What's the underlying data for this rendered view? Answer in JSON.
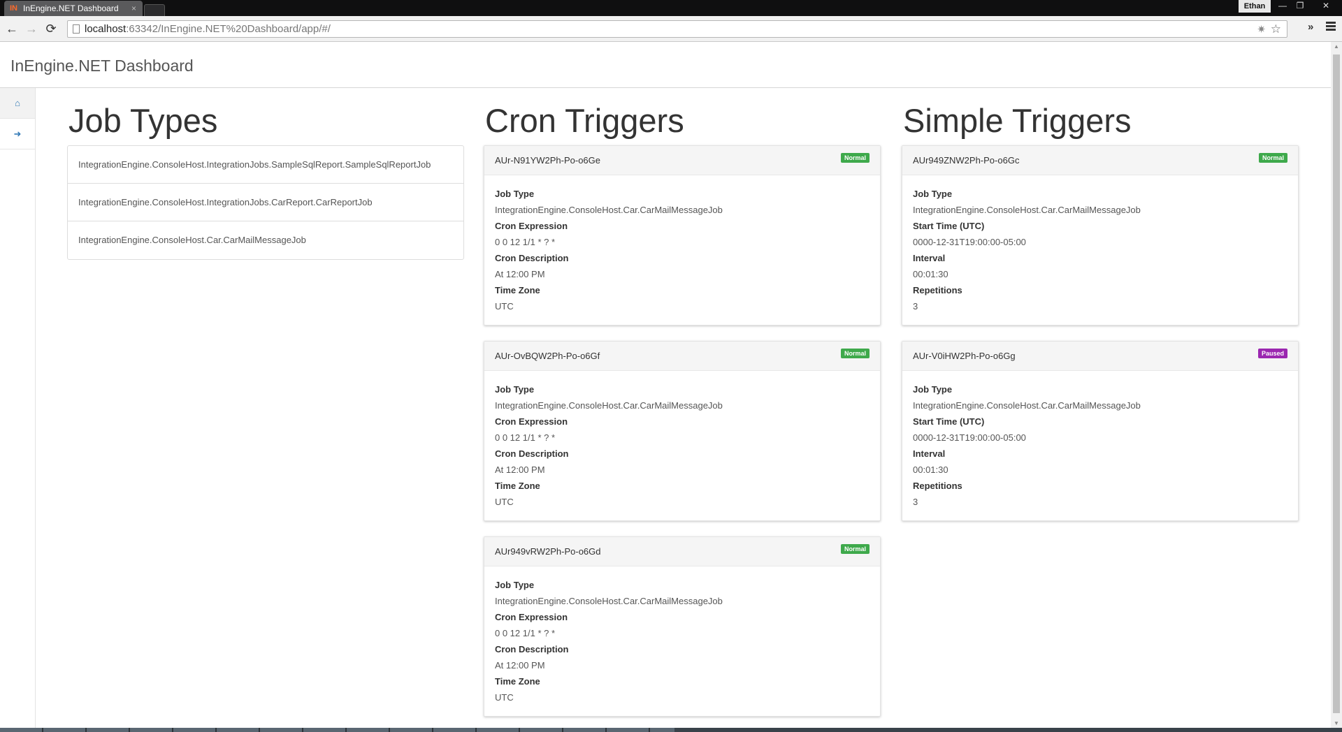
{
  "browser": {
    "tab_title": "InEngine.NET Dashboard",
    "tab_close": "×",
    "favicon_text": "IN",
    "user_name": "Ethan",
    "window_controls": {
      "minimize": "—",
      "restore": "❐",
      "close": "✕"
    },
    "nav": {
      "back": "←",
      "forward": "→",
      "reload": "⟳"
    },
    "url_host": "localhost",
    "url_rest": ":63342/InEngine.NET%20Dashboard/app/#/",
    "star_glyph": "☆",
    "ext_glyph": "✷",
    "overflow_glyph": "»"
  },
  "app": {
    "title": "InEngine.NET Dashboard"
  },
  "sidebar": {
    "items": [
      {
        "icon": "home-icon",
        "glyph": "⌂",
        "active": true
      },
      {
        "icon": "arrow-right-icon",
        "glyph": "➜",
        "active": false
      }
    ]
  },
  "job_types": {
    "heading": "Job Types",
    "items": [
      "IntegrationEngine.ConsoleHost.IntegrationJobs.SampleSqlReport.SampleSqlReportJob",
      "IntegrationEngine.ConsoleHost.IntegrationJobs.CarReport.CarReportJob",
      "IntegrationEngine.ConsoleHost.Car.CarMailMessageJob"
    ]
  },
  "cron_triggers": {
    "heading": "Cron Triggers",
    "labels": {
      "job_type": "Job Type",
      "cron_expression": "Cron Expression",
      "cron_description": "Cron Description",
      "time_zone": "Time Zone"
    },
    "items": [
      {
        "id": "AUr-N91YW2Ph-Po-o6Ge",
        "state": "Normal",
        "job_type": "IntegrationEngine.ConsoleHost.Car.CarMailMessageJob",
        "cron_expression": "0 0 12 1/1 * ? *",
        "cron_description": "At 12:00 PM",
        "time_zone": "UTC"
      },
      {
        "id": "AUr-OvBQW2Ph-Po-o6Gf",
        "state": "Normal",
        "job_type": "IntegrationEngine.ConsoleHost.Car.CarMailMessageJob",
        "cron_expression": "0 0 12 1/1 * ? *",
        "cron_description": "At 12:00 PM",
        "time_zone": "UTC"
      },
      {
        "id": "AUr949vRW2Ph-Po-o6Gd",
        "state": "Normal",
        "job_type": "IntegrationEngine.ConsoleHost.Car.CarMailMessageJob",
        "cron_expression": "0 0 12 1/1 * ? *",
        "cron_description": "At 12:00 PM",
        "time_zone": "UTC"
      }
    ]
  },
  "simple_triggers": {
    "heading": "Simple Triggers",
    "labels": {
      "job_type": "Job Type",
      "start_time": "Start Time (UTC)",
      "interval": "Interval",
      "repetitions": "Repetitions"
    },
    "items": [
      {
        "id": "AUr949ZNW2Ph-Po-o6Gc",
        "state": "Normal",
        "job_type": "IntegrationEngine.ConsoleHost.Car.CarMailMessageJob",
        "start_time": "0000-12-31T19:00:00-05:00",
        "interval": "00:01:30",
        "repetitions": "3"
      },
      {
        "id": "AUr-V0iHW2Ph-Po-o6Gg",
        "state": "Paused",
        "job_type": "IntegrationEngine.ConsoleHost.Car.CarMailMessageJob",
        "start_time": "0000-12-31T19:00:00-05:00",
        "interval": "00:01:30",
        "repetitions": "3"
      }
    ]
  },
  "colors": {
    "badge_normal": "#3ea94b",
    "badge_paused": "#9b27b0",
    "link_blue": "#337ab7"
  }
}
